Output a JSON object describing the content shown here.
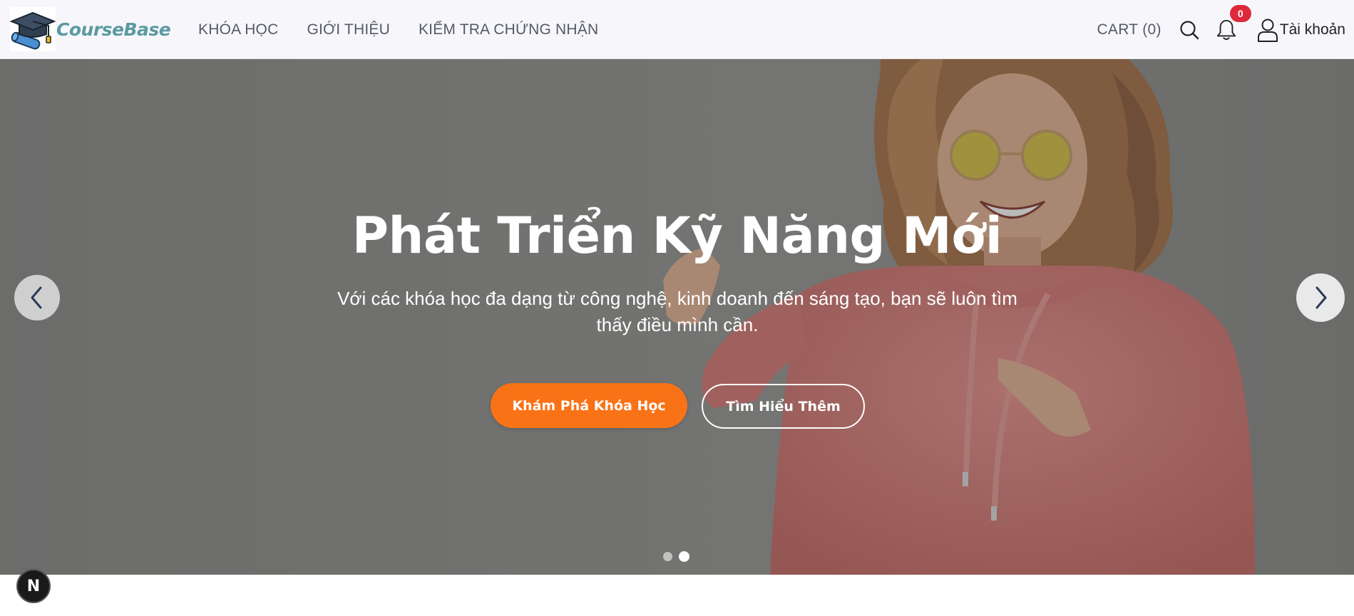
{
  "brand": {
    "name": "CourseBase",
    "icon": "graduation-cap-icon",
    "color": "#5b9aa0"
  },
  "nav": {
    "links": [
      {
        "label": "KHÓA HỌC"
      },
      {
        "label": "GIỚI THIỆU"
      },
      {
        "label": "KIỂM TRA CHỨNG NHẬN"
      }
    ],
    "cart_label": "CART (0)",
    "search_icon": "search-icon",
    "notifications": {
      "icon": "bell-icon",
      "count": "0",
      "badge_color": "#e0283b"
    },
    "account": {
      "icon": "user-icon",
      "label": "Tài khoản"
    }
  },
  "hero": {
    "title": "Phát Triển Kỹ Năng Mới",
    "subtitle": "Với các khóa học đa dạng từ công nghệ, kinh doanh đến sáng tạo, bạn sẽ luôn tìm thấy điều mình cần.",
    "primary_button": "Khám Phá Khóa Học",
    "secondary_button": "Tìm Hiểu Thêm",
    "primary_color": "#f97316",
    "prev_icon": "chevron-left-icon",
    "next_icon": "chevron-right-icon",
    "slides": {
      "count": 2,
      "active": 2
    }
  },
  "dev_badge": {
    "label": "N"
  }
}
